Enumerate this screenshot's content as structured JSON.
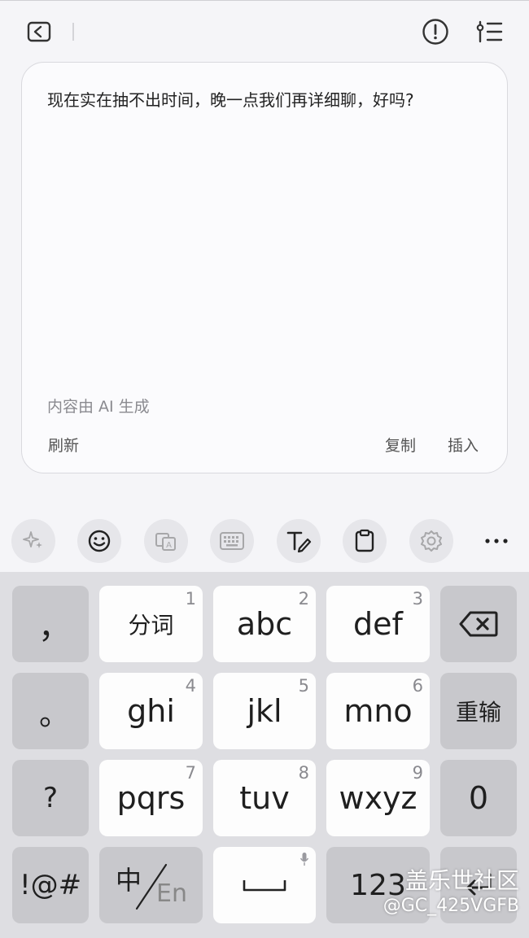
{
  "header": {
    "back_icon": "back-arrow-icon",
    "alert_icon": "alert-circle-icon",
    "filter_icon": "list-filter-icon"
  },
  "card": {
    "text": "现在实在抽不出时间，晚一点我们再详细聊，好吗?",
    "ai_note": "内容由 AI 生成",
    "refresh_label": "刷新",
    "copy_label": "复制",
    "insert_label": "插入"
  },
  "toolbar": {
    "icons": [
      "sparkle-icon",
      "emoji-icon",
      "translate-icon",
      "keyboard-icon",
      "text-edit-icon",
      "clipboard-icon",
      "settings-icon",
      "more-icon"
    ]
  },
  "keyboard": {
    "row1": {
      "comma": "，",
      "k1": {
        "label": "分词",
        "num": "1"
      },
      "k2": {
        "label": "abc",
        "num": "2"
      },
      "k3": {
        "label": "def",
        "num": "3"
      },
      "backspace_icon": "backspace-icon"
    },
    "row2": {
      "period": "。",
      "k4": {
        "label": "ghi",
        "num": "4"
      },
      "k5": {
        "label": "jkl",
        "num": "5"
      },
      "k6": {
        "label": "mno",
        "num": "6"
      },
      "retype": "重输"
    },
    "row3": {
      "question": "?",
      "k7": {
        "label": "pqrs",
        "num": "7"
      },
      "k8": {
        "label": "tuv",
        "num": "8"
      },
      "k9": {
        "label": "wxyz",
        "num": "9"
      },
      "zero": "0"
    },
    "row4": {
      "symbols": "!@#",
      "lang_cn": "中",
      "lang_en": "En",
      "space_icon": "space-bar-icon",
      "mic_icon": "mic-icon",
      "numbers": "123"
    }
  },
  "watermark": {
    "line1": "盖乐世社区",
    "line2": "@GC_425VGFB"
  }
}
